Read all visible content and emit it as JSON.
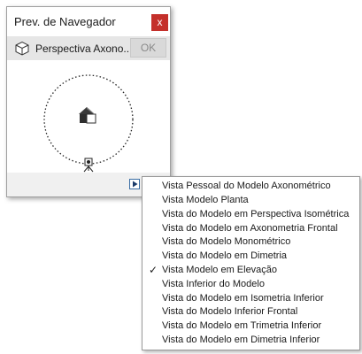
{
  "window": {
    "title": "Prev. de Navegador",
    "close_glyph": "x"
  },
  "viewbar": {
    "icon": "cube-icon",
    "view_name": "Perspectiva Axono...",
    "ok_label": "OK"
  },
  "preview": {
    "icons": [
      "house-icon",
      "camera-tripod-icon"
    ]
  },
  "footer": {
    "menu_toggle_icon": "triangle-right-icon"
  },
  "menu": {
    "checked_index": 6,
    "items": [
      {
        "label": "Vista Pessoal do Modelo Axonométrico"
      },
      {
        "label": "Vista Modelo Planta"
      },
      {
        "label": "Vista do Modelo em Perspectiva Isométrica"
      },
      {
        "label": "Vista do Modelo em Axonometria Frontal"
      },
      {
        "label": "Vista do Modelo Monométrico"
      },
      {
        "label": "Vista do Modelo em Dimetria"
      },
      {
        "label": "Vista Modelo em Elevação"
      },
      {
        "label": "Vista Inferior do Modelo"
      },
      {
        "label": "Vista do Modelo em Isometria Inferior"
      },
      {
        "label": "Vista do Modelo Inferior Frontal"
      },
      {
        "label": "Vista do Modelo em Trimetria Inferior"
      },
      {
        "label": "Vista do Modelo em Dimetria Inferior"
      }
    ]
  },
  "colors": {
    "close_button": "#c4302b",
    "accent": "#3a6ea5"
  }
}
